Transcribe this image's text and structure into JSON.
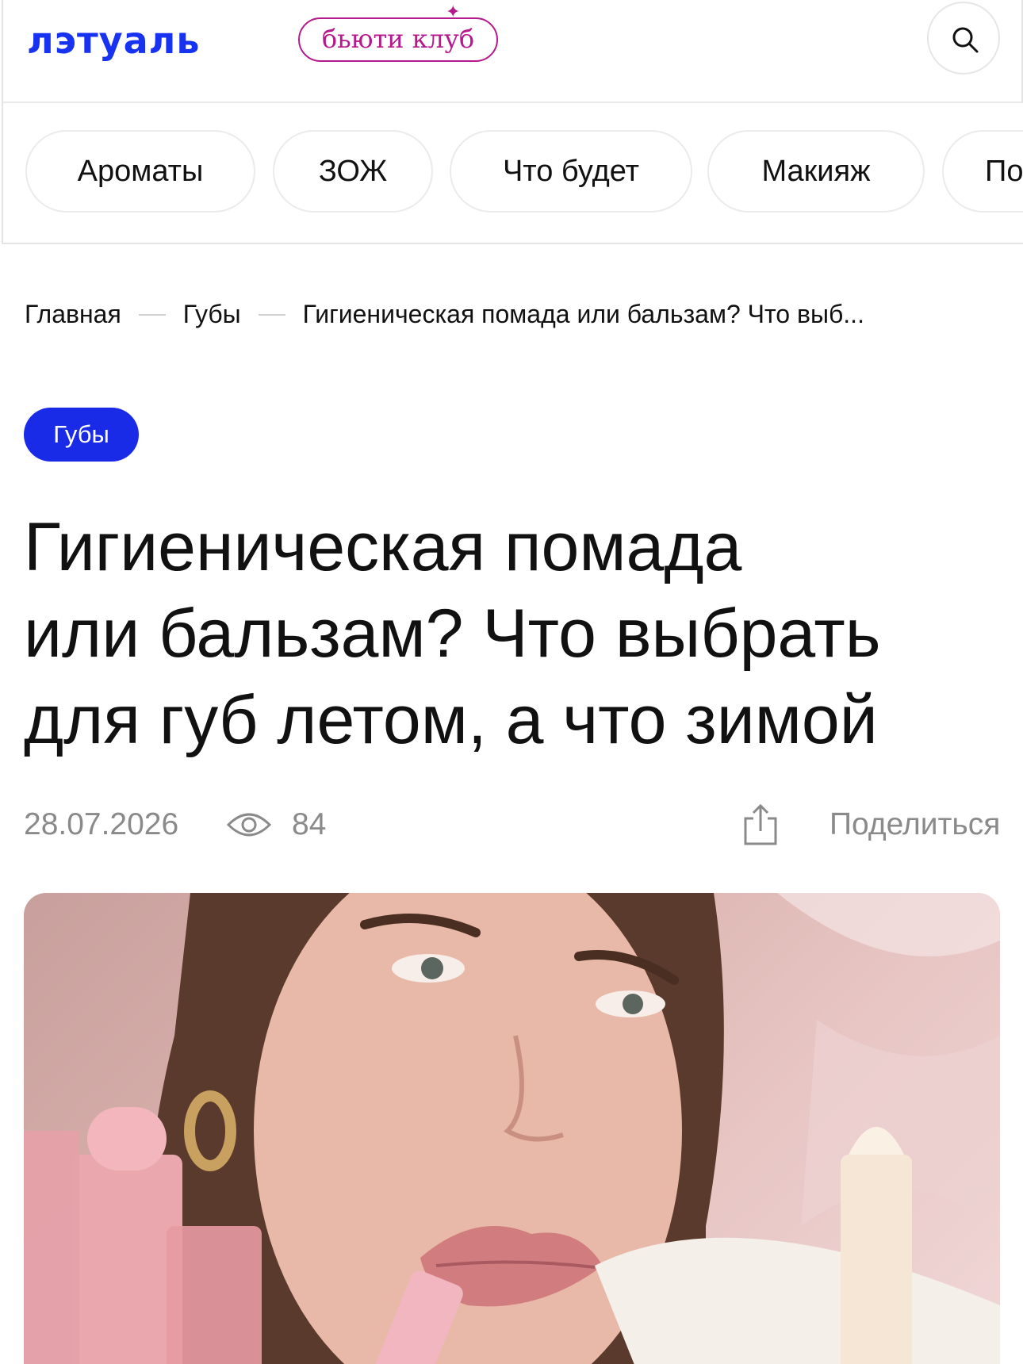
{
  "header": {
    "logo_text": "лэтуаль",
    "club_badge": "бьюти клуб",
    "brand_color": "#1732f0",
    "club_color": "#b5198c"
  },
  "tabs": [
    {
      "label": "Ароматы"
    },
    {
      "label": "ЗОЖ"
    },
    {
      "label": "Что будет"
    },
    {
      "label": "Макияж"
    },
    {
      "label": "По"
    }
  ],
  "breadcrumb": {
    "home": "Главная",
    "section": "Губы",
    "current": "Гигиеническая помада или бальзам? Что выб..."
  },
  "article": {
    "tag": "Губы",
    "tag_color": "#1a2be8",
    "title_line1": "Гигиеническая помада",
    "title_line2": "или бальзам? Что выбрать",
    "title_line3": "для губ летом, а что зимой",
    "date": "28.07.2026",
    "views": "84",
    "share_label": "Поделиться"
  }
}
